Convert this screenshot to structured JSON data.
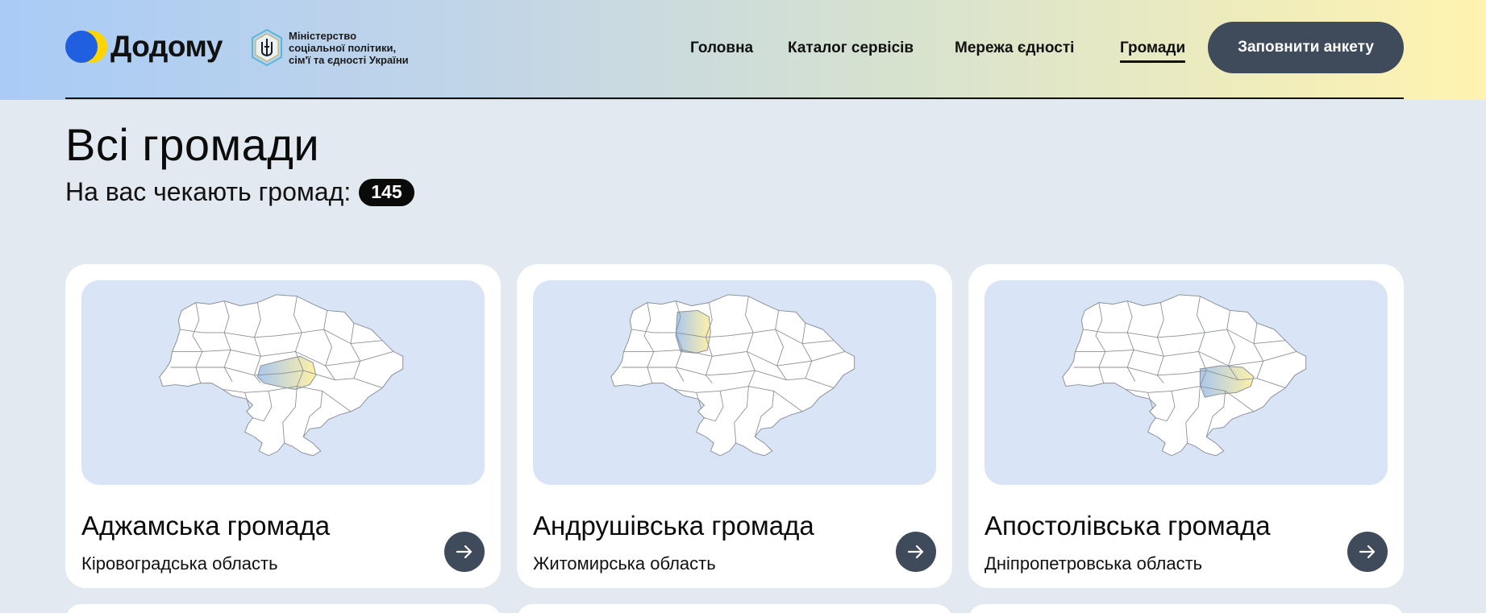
{
  "header": {
    "logo_text": "Додому",
    "ministry_lines": [
      "Міністерство",
      "соціальної політики,",
      "сім'ї та єдності України"
    ],
    "nav": [
      {
        "label": "Головна",
        "active": false
      },
      {
        "label": "Каталог сервісів",
        "active": false
      },
      {
        "label": "Мережа єдності",
        "active": false
      },
      {
        "label": "Громади",
        "active": true
      }
    ],
    "cta_label": "Заповнити анкету"
  },
  "main": {
    "title": "Всі громади",
    "subtitle": "На вас чекають громад:",
    "count": "145",
    "cards": [
      {
        "title": "Аджамська громада",
        "region": "Кіровоградська область",
        "highlighted_oblast": "kirovohrad"
      },
      {
        "title": "Андрушівська громада",
        "region": "Житомирська область",
        "highlighted_oblast": "zhytomyr"
      },
      {
        "title": "Апостолівська громада",
        "region": "Дніпропетровська область",
        "highlighted_oblast": "dnipro"
      }
    ]
  },
  "colors": {
    "accent_dark": "#3f4a5b",
    "map_bg": "#d9e5f6",
    "highlight_blue": "#a9c8ee",
    "highlight_yellow": "#fff1a6",
    "logo_blue": "#1f5fe0",
    "logo_yellow": "#ffd500"
  }
}
